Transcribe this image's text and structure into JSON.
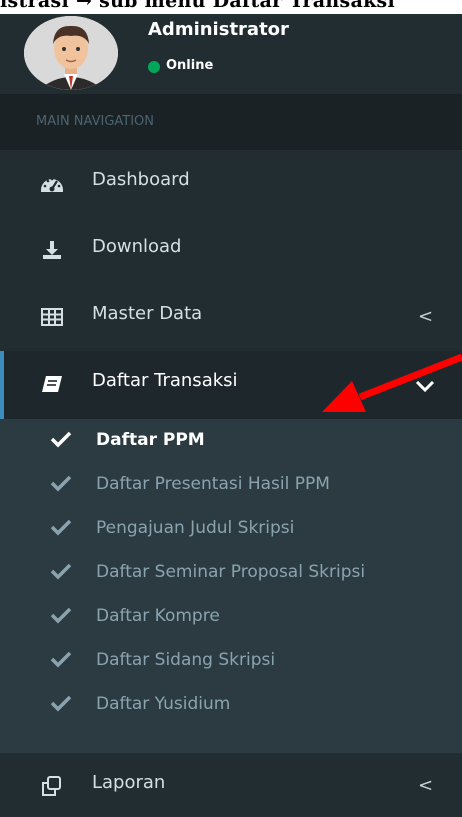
{
  "top_strip": {
    "text": "istrasi → sub menu Daftar Transaksi"
  },
  "user": {
    "name": "Administrator",
    "status": "Online",
    "status_color": "#00a65a"
  },
  "nav_header": "MAIN NAVIGATION",
  "menu": [
    {
      "label": "Dashboard",
      "icon": "dashboard-icon"
    },
    {
      "label": "Download",
      "icon": "download-icon"
    },
    {
      "label": "Master Data",
      "icon": "table-icon",
      "chevron": "<"
    },
    {
      "label": "Daftar Transaksi",
      "icon": "book-icon",
      "active": true
    }
  ],
  "submenu": [
    {
      "label": "Daftar PPM"
    },
    {
      "label": "Daftar Presentasi Hasil PPM"
    },
    {
      "label": "Pengajuan Judul Skripsi"
    },
    {
      "label": "Daftar Seminar Proposal Skripsi"
    },
    {
      "label": "Daftar Kompre"
    },
    {
      "label": "Daftar Sidang Skripsi"
    },
    {
      "label": "Daftar Yusidium"
    }
  ],
  "bottom_menu": {
    "label": "Laporan",
    "icon": "copy-icon",
    "chevron": "<"
  },
  "colors": {
    "sidebar_bg": "#222d32",
    "header_bg": "#1a2226",
    "submenu_bg": "#2c3b41",
    "accent": "#3c8dbc",
    "annotation_arrow": "#ff0000"
  }
}
